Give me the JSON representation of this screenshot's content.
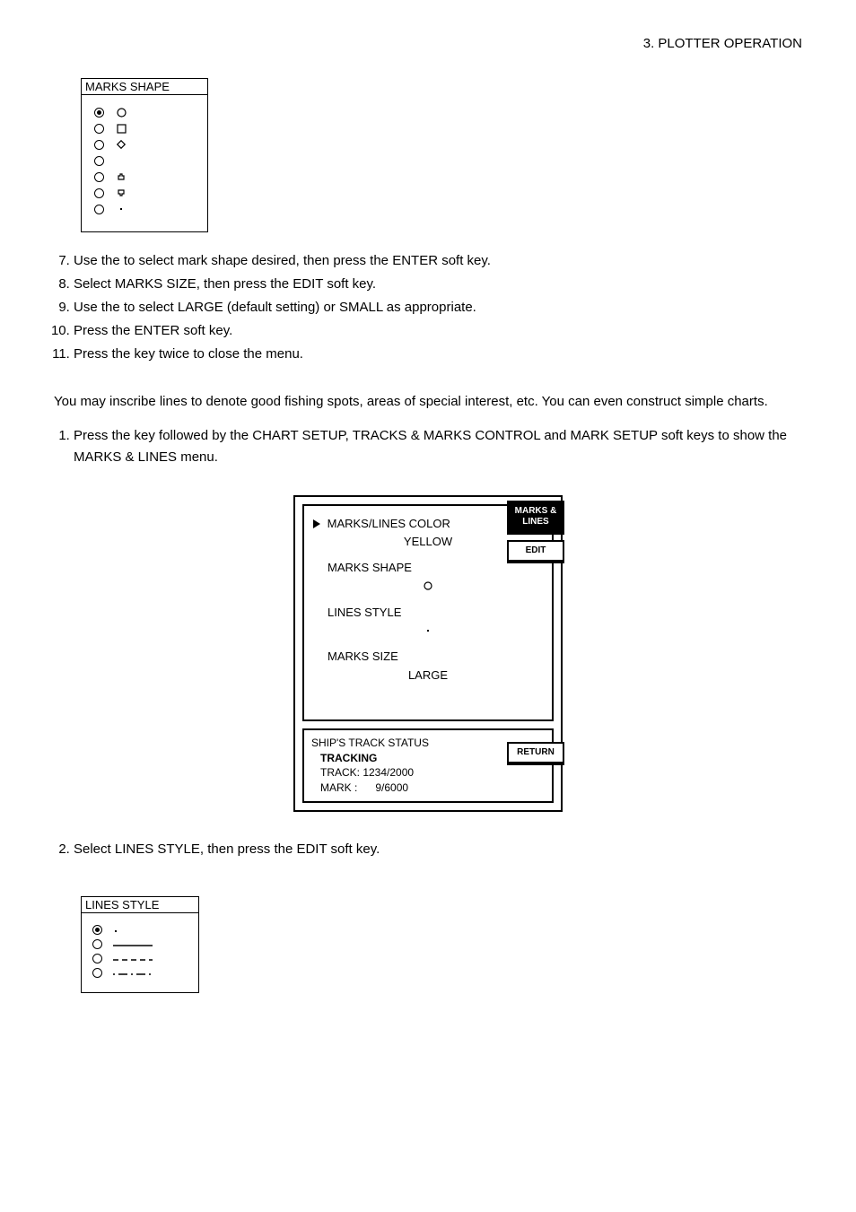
{
  "header": "3.  PLOTTER  OPERATION",
  "marks_shape_box": {
    "title": "MARKS SHAPE"
  },
  "steps1": {
    "s7": "Use the                      to select mark shape desired, then press the ENTER soft key.",
    "s8": "Select MARKS SIZE, then press the EDIT soft key.",
    "s9": "Use the                      to select LARGE (default setting) or SMALL as appropriate.",
    "s10": "Press the ENTER soft key.",
    "s11": "Press the              key twice to close the menu."
  },
  "section": "",
  "intro": "You may inscribe lines to denote good fishing spots, areas of special interest, etc. You can even construct simple charts.",
  "step_press": "Press the             key followed by the CHART SETUP, TRACKS & MARKS CONTROL and MARK SETUP soft keys to show the MARKS & LINES menu.",
  "menu": {
    "title_key": "MARKS & LINES",
    "edit_key": "EDIT",
    "return_key": "RETURN",
    "item1_label": "MARKS/LINES COLOR",
    "item1_value": "YELLOW",
    "item2_label": "MARKS SHAPE",
    "item3_label": "LINES STYLE",
    "item4_label": "MARKS SIZE",
    "item4_value": "LARGE",
    "status_title": "SHIP'S TRACK STATUS",
    "tracking": "TRACKING",
    "track": "TRACK: 1234/2000",
    "mark": "MARK :      9/6000"
  },
  "step2": "Select LINES STYLE, then press the EDIT soft key.",
  "lines_style_box": {
    "title": "LINES STYLE"
  }
}
